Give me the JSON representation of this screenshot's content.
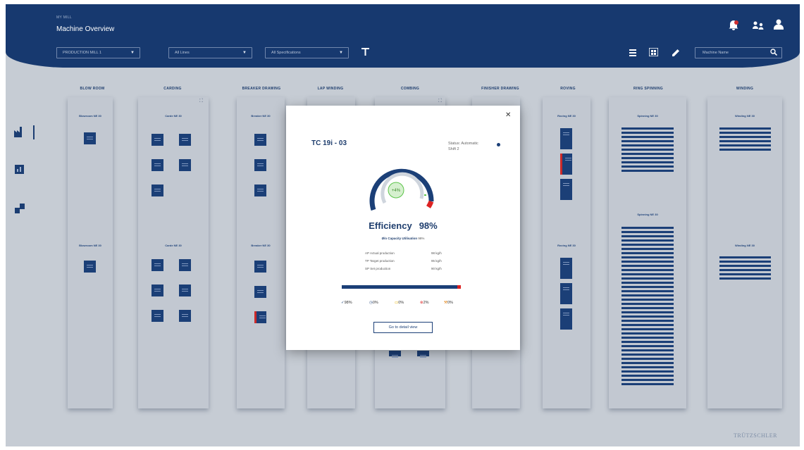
{
  "header": {
    "small_title": "MY MILL",
    "title": "Machine Overview",
    "filters": [
      {
        "label": "PRODUCTION MILL 1"
      },
      {
        "label": "All Lines"
      },
      {
        "label": "All Specifications"
      }
    ],
    "search_placeholder": "Machine Name",
    "icons": [
      "alarm-bell-icon",
      "users-icon",
      "profile-icon",
      "filter-icon",
      "list-view-icon",
      "grid-view-icon",
      "edit-icon",
      "search-icon"
    ]
  },
  "columns": [
    "BLOW ROOM",
    "CARDING",
    "BREAKER DRAWING",
    "LAP WINDING",
    "COMBING",
    "FINISHER DRAWING",
    "ROVING",
    "RING SPINNING",
    "WINDING"
  ],
  "groups": {
    "blowroom": [
      "Blowroom NE 30",
      "Blowroom NE 30"
    ],
    "carding": [
      "Carde NE 30",
      "Carde NE 30"
    ],
    "breaker": [
      "Breaker NE 30",
      "Breaker NE 30"
    ],
    "roving": [
      "Roving NE 30",
      "Roving NE 30"
    ],
    "ring": [
      "Spinning NE 30",
      "Spinning NE 30"
    ],
    "winding": [
      "Winding NE 30",
      "Winding NE 30"
    ]
  },
  "modal": {
    "machine_id": "TC 19i - 03",
    "status_line": "Status: Automatic",
    "shift_line": "Shift 2",
    "gauge_label": "+4%",
    "efficiency_label": "Efficiency",
    "efficiency_value": "98%",
    "utilization_label": "Ø/o Capacity Utilisation",
    "utilization_value": "98%",
    "rows": [
      {
        "code": "AP",
        "label": "Actual production",
        "value": "98 kg/h"
      },
      {
        "code": "TP",
        "label": "Target production",
        "value": "95 kg/h"
      },
      {
        "code": "SP",
        "label": "Set production",
        "value": "90 kg/h"
      }
    ],
    "stats": [
      "98%",
      "0%",
      "0%",
      "2%",
      "0%"
    ],
    "detail_button": "Go to detail view",
    "progress_fraction": 0.98
  },
  "brand": "TRÜTZSCHLER",
  "colors": {
    "primary": "#17396f",
    "background": "#c6ccd4",
    "alert": "#cc2a2a",
    "gauge_green": "#5cc44a"
  }
}
